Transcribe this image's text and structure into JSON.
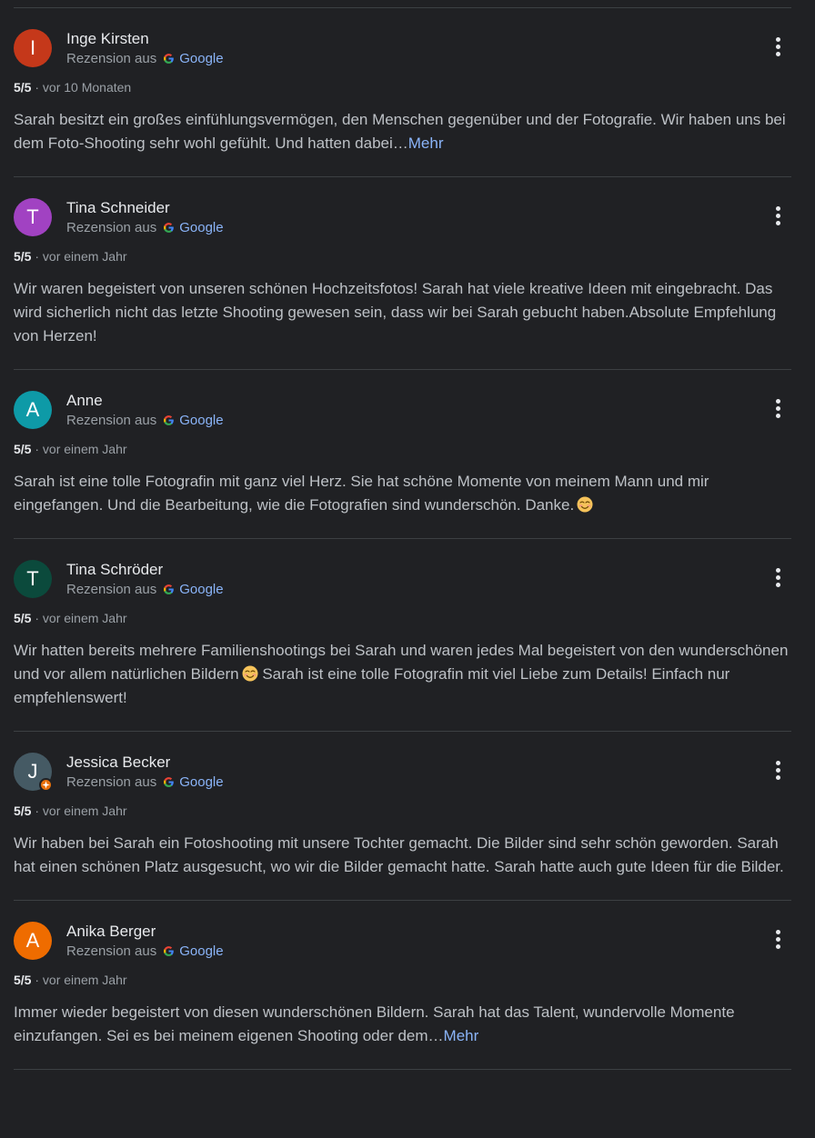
{
  "reviews": [
    {
      "initial": "I",
      "avatar_color": "#c5381a",
      "name": "Inge Kirsten",
      "source_prefix": "Rezension aus",
      "source_name": "Google",
      "rating": "5/5",
      "separator": "·",
      "date": "vor 10 Monaten",
      "text": "Sarah besitzt ein großes einfühlungsvermögen, den Menschen gegenüber und der Fotografie. Wir haben uns bei dem Foto-Shooting sehr wohl gefühlt. Und hatten dabei…",
      "more": "Mehr"
    },
    {
      "initial": "T",
      "avatar_color": "#a142c2",
      "name": "Tina Schneider",
      "source_prefix": "Rezension aus",
      "source_name": "Google",
      "rating": "5/5",
      "separator": "·",
      "date": "vor einem Jahr",
      "text": "Wir waren begeistert von unseren schönen Hochzeitsfotos! Sarah hat viele kreative Ideen mit eingebracht. Das wird sicherlich nicht das letzte Shooting gewesen sein, dass wir bei Sarah gebucht haben.Absolute Empfehlung von Herzen!"
    },
    {
      "initial": "A",
      "avatar_color": "#0e9aa7",
      "name": "Anne",
      "source_prefix": "Rezension aus",
      "source_name": "Google",
      "rating": "5/5",
      "separator": "·",
      "date": "vor einem Jahr",
      "text": "Sarah ist eine tolle Fotografin mit ganz viel Herz. Sie hat schöne Momente von meinem Mann und mir eingefangen. Und die Bearbeitung, wie die Fotografien sind wunderschön. Danke."
    },
    {
      "initial": "T",
      "avatar_color": "#0b4a3c",
      "name": "Tina Schröder",
      "source_prefix": "Rezension aus",
      "source_name": "Google",
      "rating": "5/5",
      "separator": "·",
      "date": "vor einem Jahr",
      "text_before_emoji": "Wir hatten bereits mehrere Familienshootings bei Sarah und waren jedes Mal begeistert von den wunderschönen und vor allem natürlichen Bildern",
      "text_after_emoji": " Sarah ist eine tolle Fotografin mit viel Liebe zum Details! Einfach nur empfehlenswert!"
    },
    {
      "initial": "J",
      "avatar_color": "#455a64",
      "local_guide_badge": true,
      "name": "Jessica Becker",
      "source_prefix": "Rezension aus",
      "source_name": "Google",
      "rating": "5/5",
      "separator": "·",
      "date": "vor einem Jahr",
      "text": "Wir haben bei Sarah ein Fotoshooting mit unsere Tochter gemacht. Die Bilder sind sehr schön geworden. Sarah hat einen schönen Platz ausgesucht, wo wir die Bilder gemacht hatte. Sarah hatte auch gute Ideen für die Bilder."
    },
    {
      "initial": "A",
      "avatar_color": "#ef6c00",
      "name": "Anika Berger",
      "source_prefix": "Rezension aus",
      "source_name": "Google",
      "rating": "5/5",
      "separator": "·",
      "date": "vor einem Jahr",
      "text": "Immer wieder begeistert von diesen wunderschönen Bildern. Sarah hat das Talent, wundervolle Momente einzufangen. Sei es bei meinem eigenen Shooting oder dem…",
      "more": "Mehr"
    }
  ],
  "icons": {
    "google": "google-g-icon",
    "menu": "more-vert-icon",
    "emoji": "smiling-face-emoji",
    "badge": "local-guide-badge-icon"
  }
}
